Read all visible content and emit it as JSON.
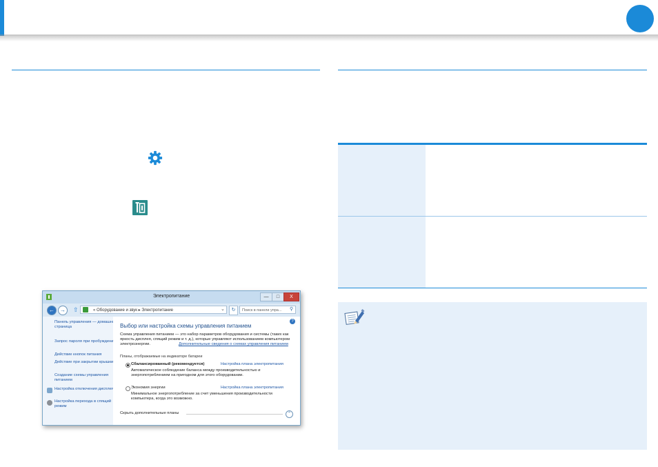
{
  "colors": {
    "accent": "#1b8ad8",
    "table_bg": "#e6f0fa"
  },
  "icons": {
    "gear": "gear-icon",
    "power_settings": "power-settings-icon",
    "note": "note-pencil-icon"
  },
  "window": {
    "title": "Электропитание",
    "minimize": "—",
    "maximize": "□",
    "close": "X",
    "breadcrumb": "« Оборудование и звук ▸ Электропитание",
    "breadcrumb_chevron": "⌄",
    "refresh": "↻",
    "search_placeholder": "Поиск в панели упра...",
    "help": "?",
    "sidebar": {
      "home": "Панель управления — домашняя страница",
      "links": [
        "Запрос пароля при пробуждении",
        "Действие кнопок питания",
        "Действие при закрытии крышки",
        "Создание схемы управления питанием",
        "Настройка отключения дисплея",
        "Настройка перехода в спящий режим"
      ]
    },
    "main": {
      "heading": "Выбор или настройка схемы управления питанием",
      "description": "Схема управления питанием — это набор параметров оборудования и системы (таких как яркость дисплея, спящий режим и т. д.), которые управляют использованием компьютером электроэнергии.",
      "description_link": "Дополнительные сведения о схемах управления питанием",
      "plans_label": "Планы, отображаемые на индикаторе батареи",
      "plans": [
        {
          "name": "Сбалансированный (рекомендуется)",
          "selected": true,
          "link": "Настройка плана электропитания",
          "desc": "Автоматическое соблюдение баланса между производительностью и энергопотреблением на пригодном для этого оборудовании."
        },
        {
          "name": "Экономия энергии",
          "selected": false,
          "link": "Настройка плана электропитания",
          "desc": "Минимальное энергопотребление за счет уменьшения производительности компьютера, когда это возможно."
        }
      ],
      "hide_more": "Скрыть дополнительные планы",
      "expand": "⌃"
    }
  }
}
